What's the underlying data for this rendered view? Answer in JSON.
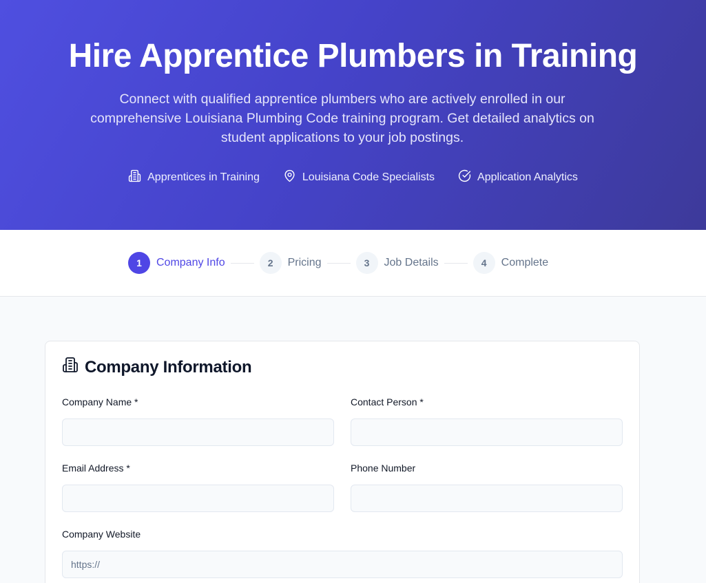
{
  "hero": {
    "title": "Hire Apprentice Plumbers in Training",
    "subtitle": "Connect with qualified apprentice plumbers who are actively enrolled in our comprehensive Louisiana Plumbing Code training program. Get detailed analytics on student applications to your job postings.",
    "features": [
      {
        "icon": "building-icon",
        "label": "Apprentices in Training"
      },
      {
        "icon": "map-pin-icon",
        "label": "Louisiana Code Specialists"
      },
      {
        "icon": "check-circle-icon",
        "label": "Application Analytics"
      }
    ]
  },
  "stepper": {
    "steps": [
      {
        "number": "1",
        "label": "Company Info",
        "active": true
      },
      {
        "number": "2",
        "label": "Pricing",
        "active": false
      },
      {
        "number": "3",
        "label": "Job Details",
        "active": false
      },
      {
        "number": "4",
        "label": "Complete",
        "active": false
      }
    ]
  },
  "form": {
    "section_icon": "building-icon",
    "section_title": "Company Information",
    "fields": {
      "company_name": {
        "label": "Company Name *",
        "value": "",
        "placeholder": ""
      },
      "contact_person": {
        "label": "Contact Person *",
        "value": "",
        "placeholder": ""
      },
      "email": {
        "label": "Email Address *",
        "value": "",
        "placeholder": ""
      },
      "phone": {
        "label": "Phone Number",
        "value": "",
        "placeholder": ""
      },
      "website": {
        "label": "Company Website",
        "value": "",
        "placeholder": "https://"
      }
    }
  },
  "colors": {
    "accent": "#4f46e5",
    "hero_gradient_start": "#4f4fe0",
    "hero_gradient_end": "#3d3a9a"
  }
}
